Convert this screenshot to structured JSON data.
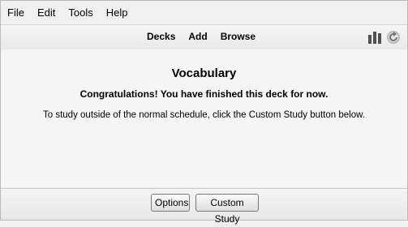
{
  "menubar": {
    "items": [
      "File",
      "Edit",
      "Tools",
      "Help"
    ]
  },
  "toolbar": {
    "links": [
      "Decks",
      "Add",
      "Browse"
    ],
    "icons": [
      "stats-icon",
      "sync-icon"
    ]
  },
  "main": {
    "deck_title": "Vocabulary",
    "congrats": "Congratulations! You have finished this deck for now.",
    "custom_info": "To study outside of the normal schedule, click the Custom Study button below."
  },
  "bottom": {
    "options_label": "Options",
    "custom_study_label": "Custom Study"
  },
  "colors": {
    "stats_icon": "#505050",
    "sync_icon": "#8a8a8a"
  }
}
